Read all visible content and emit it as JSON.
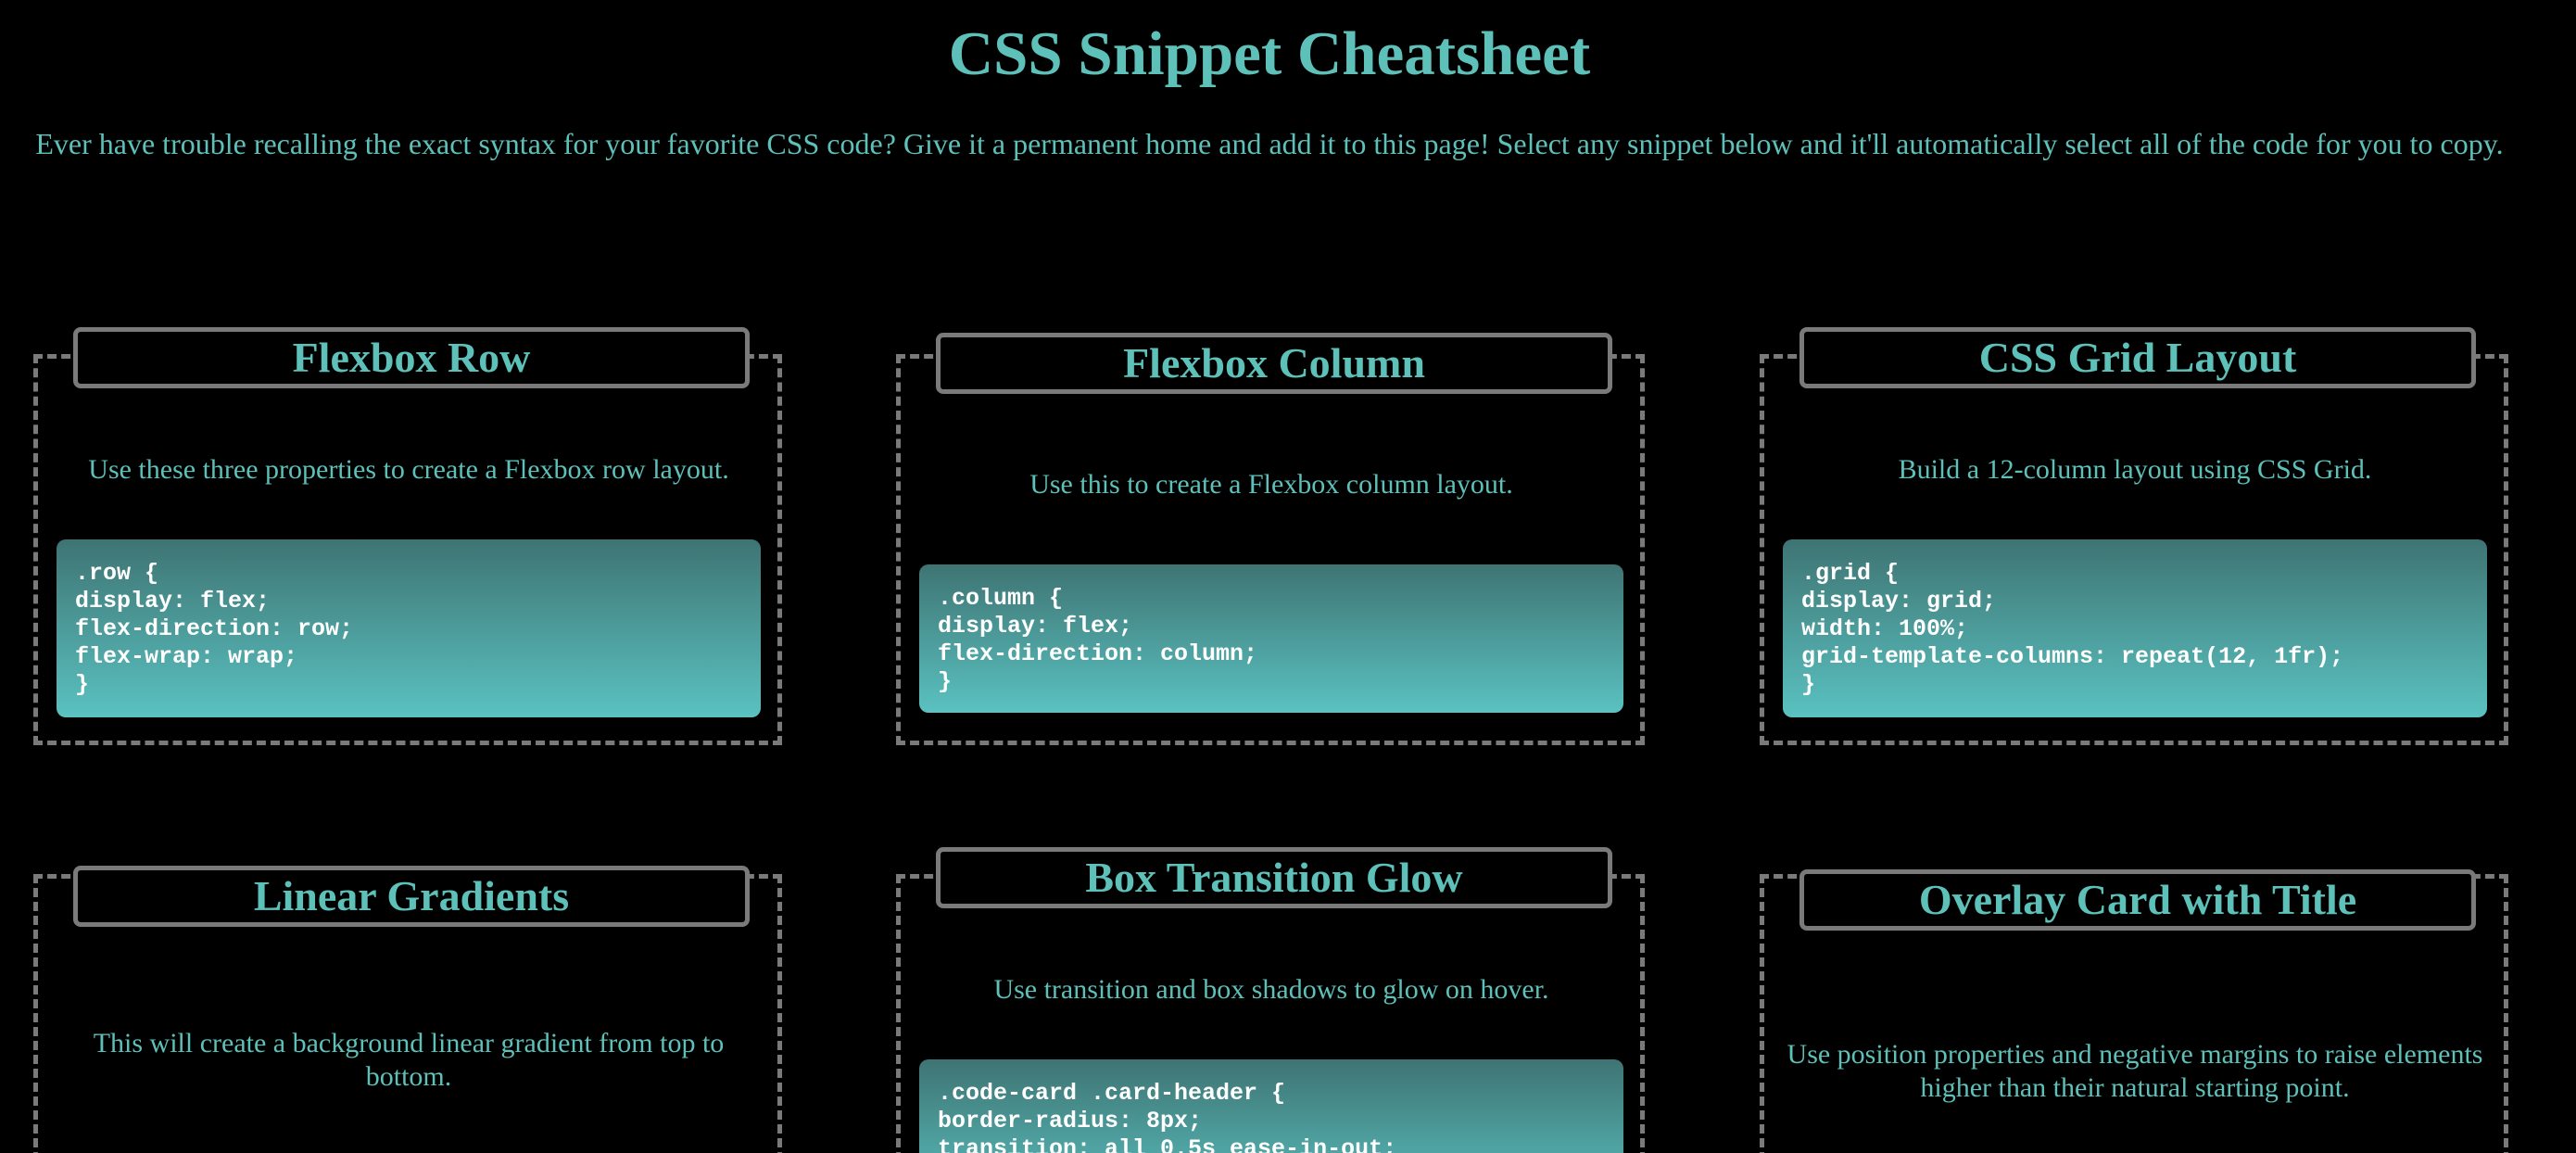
{
  "page": {
    "title": "CSS Snippet Cheatsheet",
    "intro": "Ever have trouble recalling the exact syntax for your favorite CSS code? Give it a permanent home and add it to this page! Select any snippet below and it'll automatically select all of the code for you to copy."
  },
  "colors": {
    "background": "#000000",
    "accent": "#5dc1b9",
    "border": "#7a7a7a",
    "code_gradient_top": "#3e7473",
    "code_gradient_bottom": "#5ac2c1",
    "code_text": "#ffffff"
  },
  "cards": [
    {
      "title": "Flexbox Row",
      "description": "Use these three properties to create a Flexbox row layout.",
      "code": ".row {\ndisplay: flex;\nflex-direction: row;\nflex-wrap: wrap;\n}"
    },
    {
      "title": "Flexbox Column",
      "description": "Use this to create a Flexbox column layout.",
      "code": ".column {\ndisplay: flex;\nflex-direction: column;\n}"
    },
    {
      "title": "CSS Grid Layout",
      "description": "Build a 12-column layout using CSS Grid.",
      "code": ".grid {\ndisplay: grid;\nwidth: 100%;\ngrid-template-columns: repeat(12, 1fr);\n}"
    },
    {
      "title": "Linear Gradients",
      "description": "This will create a background linear gradient from top to bottom."
    },
    {
      "title": "Box Transition Glow",
      "description": "Use transition and box shadows to glow on hover.",
      "code": ".code-card .card-header {\nborder-radius: 8px;\ntransition: all 0.5s ease-in-out;"
    },
    {
      "title": "Overlay Card with Title",
      "description": "Use position properties and negative margins to raise elements higher than their natural starting point."
    }
  ]
}
